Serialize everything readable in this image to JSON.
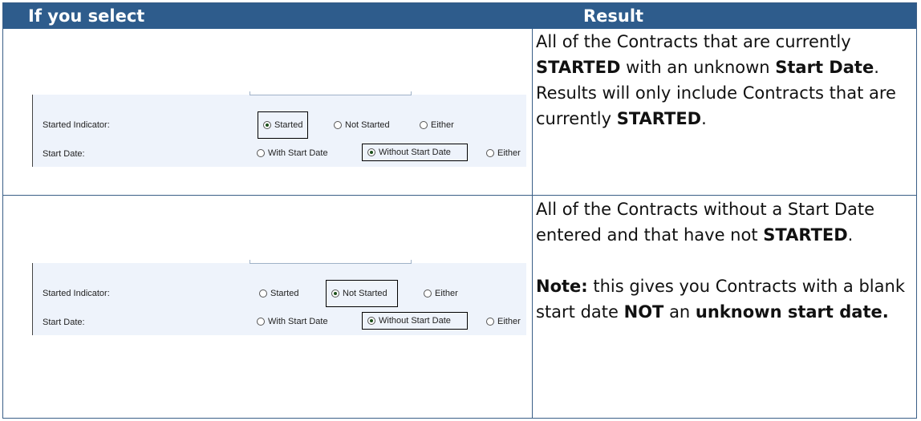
{
  "header": {
    "col1": "If you select",
    "col2": "Result"
  },
  "fields": {
    "started_indicator": "Started Indicator:",
    "start_date": "Start Date:"
  },
  "options": {
    "started": "Started",
    "not_started": "Not Started",
    "either": "Either",
    "with_start_date": "With Start Date",
    "without_start_date": "Without Start Date"
  },
  "row1": {
    "t1": "All of the Contracts that are currently ",
    "b1": "STARTED",
    "t2": " with an unknown ",
    "b2": "Start Date",
    "t3": ". Results will only include Contracts that are currently ",
    "b3": "STARTED",
    "t4": "."
  },
  "row2": {
    "t1": "All of the Contracts without a Start Date entered and that have not ",
    "b1": "STARTED",
    "t2": ".",
    "note_label": "Note:",
    "t3": " this gives you Contracts with a blank start date ",
    "b2": "NOT",
    "t4": " an ",
    "b3": "unknown start date."
  }
}
